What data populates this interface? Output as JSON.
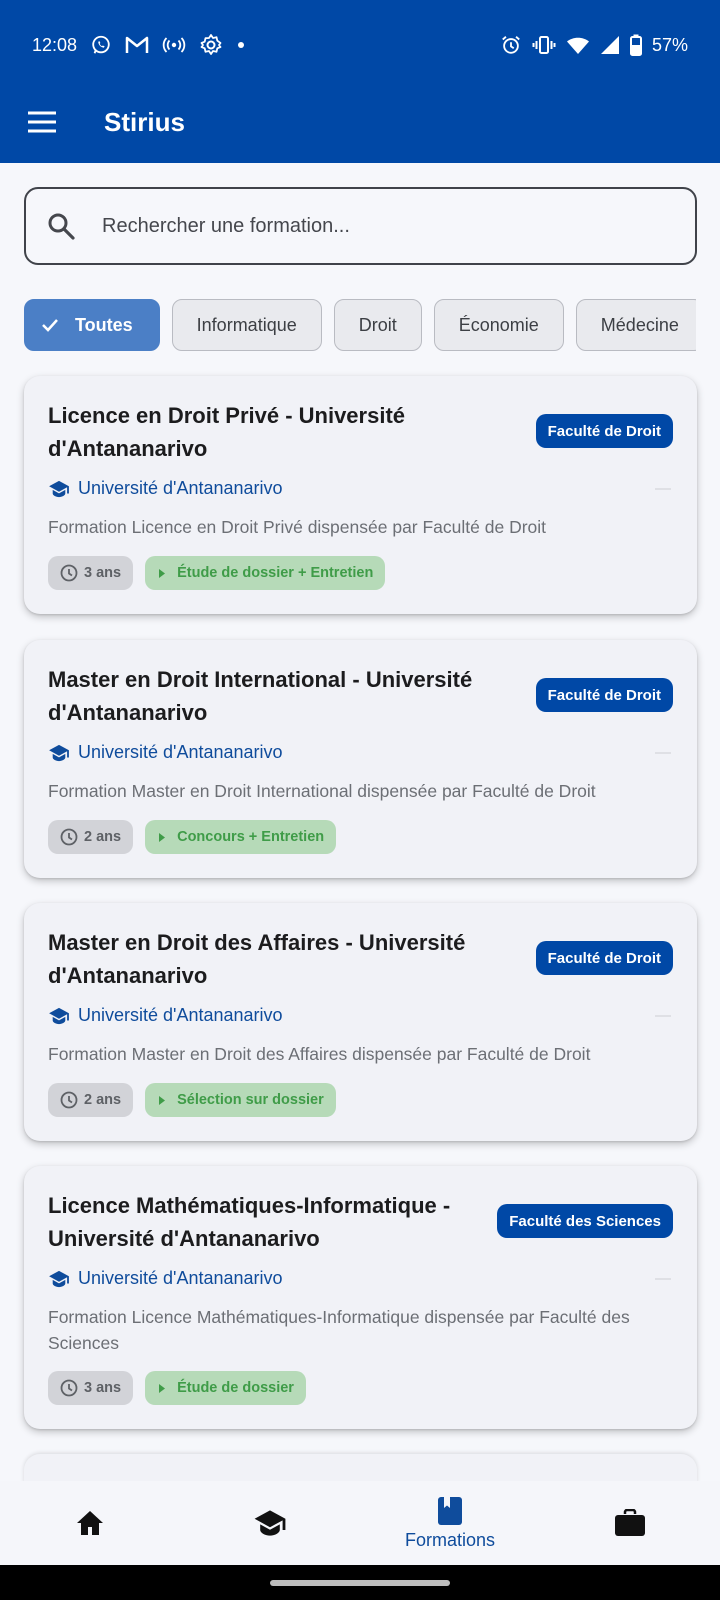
{
  "status": {
    "time": "12:08",
    "battery": "57%",
    "left_icons": [
      "whatsapp-icon",
      "gmail-icon",
      "hotspot-icon",
      "settings-icon",
      "dot-icon"
    ],
    "right_icons": [
      "alarm-icon",
      "vibrate-icon",
      "wifi-icon",
      "signal-icon",
      "battery-icon"
    ]
  },
  "appbar": {
    "title": "Stirius"
  },
  "search": {
    "placeholder": "Rechercher une formation..."
  },
  "chips": [
    {
      "label": "Toutes",
      "selected": true
    },
    {
      "label": "Informatique"
    },
    {
      "label": "Droit"
    },
    {
      "label": "Économie"
    },
    {
      "label": "Médecine"
    }
  ],
  "cards": [
    {
      "title": "Licence en Droit Privé - Université d'Antananarivo",
      "badge": "Faculté de Droit",
      "university": "Université d'Antananarivo",
      "description": "Formation Licence en Droit Privé dispensée par Faculté de Droit",
      "duration": "3 ans",
      "admission": "Étude de dossier + Entretien"
    },
    {
      "title": "Master en Droit International - Université d'Antananarivo",
      "badge": "Faculté de Droit",
      "university": "Université d'Antananarivo",
      "description": "Formation Master en Droit International dispensée par Faculté de Droit",
      "duration": "2 ans",
      "admission": "Concours + Entretien"
    },
    {
      "title": "Master en Droit des Affaires - Université d'Antananarivo",
      "badge": "Faculté de Droit",
      "university": "Université d'Antananarivo",
      "description": "Formation Master en Droit des Affaires dispensée par Faculté de Droit",
      "duration": "2 ans",
      "admission": "Sélection sur dossier"
    },
    {
      "title": "Licence Mathématiques-Informatique - Université d'Antananarivo",
      "badge": "Faculté des Sciences",
      "university": "Université d'Antananarivo",
      "description": "Formation Licence Mathématiques-Informatique dispensée par Faculté des Sciences",
      "duration": "3 ans",
      "admission": "Étude de dossier"
    }
  ],
  "bottom_nav": {
    "items": [
      {
        "icon": "home-icon",
        "label": ""
      },
      {
        "icon": "school-icon",
        "label": ""
      },
      {
        "icon": "book-icon",
        "label": "Formations",
        "active": true
      },
      {
        "icon": "briefcase-icon",
        "label": ""
      }
    ]
  },
  "colors": {
    "primary": "#0048a6",
    "chip_selected": "#4b7fc6",
    "admission_tag_bg": "#b6dab8",
    "admission_tag_text": "#3f9c48"
  }
}
